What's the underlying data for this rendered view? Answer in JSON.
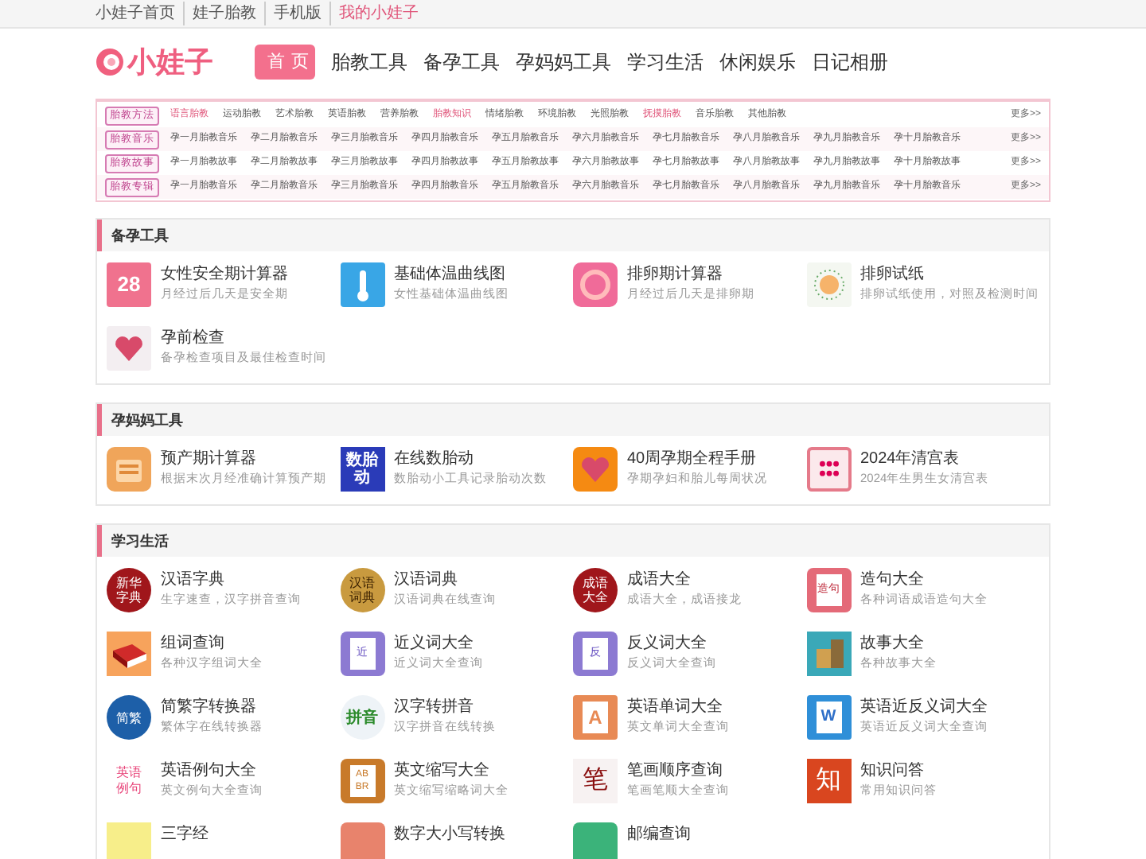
{
  "top_links": [
    "小娃子首页",
    "娃子胎教",
    "手机版",
    "我的小娃子"
  ],
  "logo": {
    "text": "小娃子"
  },
  "nav": [
    {
      "label": "首页",
      "selected": true
    },
    {
      "label": "胎教工具",
      "selected": false
    },
    {
      "label": "备孕工具",
      "selected": false
    },
    {
      "label": "孕妈妈工具",
      "selected": false
    },
    {
      "label": "学习生活",
      "selected": false
    },
    {
      "label": "休闲娱乐",
      "selected": false
    },
    {
      "label": "日记相册",
      "selected": false
    }
  ],
  "category_rows": [
    {
      "tag": "胎教方法",
      "more": "更多>>",
      "items": [
        {
          "label": "语言胎教",
          "highlighted": true
        },
        {
          "label": "运动胎教",
          "highlighted": false
        },
        {
          "label": "艺术胎教",
          "highlighted": false
        },
        {
          "label": "英语胎教",
          "highlighted": false
        },
        {
          "label": "营养胎教",
          "highlighted": false
        },
        {
          "label": "胎教知识",
          "highlighted": true
        },
        {
          "label": "情绪胎教",
          "highlighted": false
        },
        {
          "label": "环境胎教",
          "highlighted": false
        },
        {
          "label": "光照胎教",
          "highlighted": false
        },
        {
          "label": "抚摸胎教",
          "highlighted": true
        },
        {
          "label": "音乐胎教",
          "highlighted": false
        },
        {
          "label": "其他胎教",
          "highlighted": false
        }
      ]
    },
    {
      "tag": "胎教音乐",
      "more": "更多>>",
      "items": [
        {
          "label": "孕一月胎教音乐",
          "highlighted": false
        },
        {
          "label": "孕二月胎教音乐",
          "highlighted": false
        },
        {
          "label": "孕三月胎教音乐",
          "highlighted": false
        },
        {
          "label": "孕四月胎教音乐",
          "highlighted": false
        },
        {
          "label": "孕五月胎教音乐",
          "highlighted": false
        },
        {
          "label": "孕六月胎教音乐",
          "highlighted": false
        },
        {
          "label": "孕七月胎教音乐",
          "highlighted": false
        },
        {
          "label": "孕八月胎教音乐",
          "highlighted": false
        },
        {
          "label": "孕九月胎教音乐",
          "highlighted": false
        },
        {
          "label": "孕十月胎教音乐",
          "highlighted": false
        }
      ]
    },
    {
      "tag": "胎教故事",
      "more": "更多>>",
      "items": [
        {
          "label": "孕一月胎教故事",
          "highlighted": false
        },
        {
          "label": "孕二月胎教故事",
          "highlighted": false
        },
        {
          "label": "孕三月胎教故事",
          "highlighted": false
        },
        {
          "label": "孕四月胎教故事",
          "highlighted": false
        },
        {
          "label": "孕五月胎教故事",
          "highlighted": false
        },
        {
          "label": "孕六月胎教故事",
          "highlighted": false
        },
        {
          "label": "孕七月胎教故事",
          "highlighted": false
        },
        {
          "label": "孕八月胎教故事",
          "highlighted": false
        },
        {
          "label": "孕九月胎教故事",
          "highlighted": false
        },
        {
          "label": "孕十月胎教故事",
          "highlighted": false
        }
      ]
    },
    {
      "tag": "胎教专辑",
      "more": "更多>>",
      "items": [
        {
          "label": "孕一月胎教音乐",
          "highlighted": false
        },
        {
          "label": "孕二月胎教音乐",
          "highlighted": false
        },
        {
          "label": "孕三月胎教音乐",
          "highlighted": false
        },
        {
          "label": "孕四月胎教音乐",
          "highlighted": false
        },
        {
          "label": "孕五月胎教音乐",
          "highlighted": false
        },
        {
          "label": "孕六月胎教音乐",
          "highlighted": false
        },
        {
          "label": "孕七月胎教音乐",
          "highlighted": false
        },
        {
          "label": "孕八月胎教音乐",
          "highlighted": false
        },
        {
          "label": "孕九月胎教音乐",
          "highlighted": false
        },
        {
          "label": "孕十月胎教音乐",
          "highlighted": false
        }
      ]
    }
  ],
  "sections": [
    {
      "title": "备孕工具",
      "tools": [
        {
          "kind": "number",
          "icon_text": "28",
          "name": "女性安全期计算器",
          "desc": "月经过后几天是安全期"
        },
        {
          "kind": "thermometer",
          "name": "基础体温曲线图",
          "desc": "女性基础体温曲线图"
        },
        {
          "kind": "ring",
          "name": "排卵期计算器",
          "desc": "月经过后几天是排卵期"
        },
        {
          "kind": "sun",
          "name": "排卵试纸",
          "desc": "排卵试纸使用，对照及检测时间"
        },
        {
          "kind": "heart",
          "name": "孕前检查",
          "desc": "备孕检查项目及最佳检查时间"
        }
      ]
    },
    {
      "title": "孕妈妈工具",
      "tools": [
        {
          "kind": "calculator",
          "name": "预产期计算器",
          "desc": "根据末次月经准确计算预产期"
        },
        {
          "kind": "blue-text",
          "icon_text": "数胎动",
          "name": "在线数胎动",
          "desc": "数胎动小工具记录胎动次数"
        },
        {
          "kind": "card",
          "name": "40周孕期全程手册",
          "desc": "孕期孕妇和胎儿每周状况"
        },
        {
          "kind": "grid",
          "name": "2024年清宫表",
          "desc": "2024年生男生女清宫表"
        }
      ]
    },
    {
      "title": "学习生活",
      "tools": [
        {
          "kind": "red-circle",
          "icon_text": "新华字典",
          "name": "汉语字典",
          "desc": "生字速查，汉字拼音查询"
        },
        {
          "kind": "gold-circle",
          "icon_text": "汉语词典",
          "name": "汉语词典",
          "desc": "汉语词典在线查询"
        },
        {
          "kind": "red-circle",
          "icon_text": "成语大全",
          "name": "成语大全",
          "desc": "成语大全，成语接龙"
        },
        {
          "kind": "pink-book",
          "icon_text": "造句",
          "name": "造句大全",
          "desc": "各种词语成语造句大全"
        },
        {
          "kind": "red-book",
          "name": "组词查询",
          "desc": "各种汉字组词大全"
        },
        {
          "kind": "purple-doc",
          "icon_text": "近",
          "name": "近义词大全",
          "desc": "近义词大全查询"
        },
        {
          "kind": "purple-doc",
          "icon_text": "反",
          "name": "反义词大全",
          "desc": "反义词大全查询"
        },
        {
          "kind": "teal-books",
          "name": "故事大全",
          "desc": "各种故事大全"
        },
        {
          "kind": "blue-circle",
          "icon_text": "简繁",
          "name": "简繁字转换器",
          "desc": "繁体字在线转换器"
        },
        {
          "kind": "pinyin",
          "icon_text": "拼音",
          "name": "汉字转拼音",
          "desc": "汉字拼音在线转换"
        },
        {
          "kind": "letter",
          "icon_text": "A",
          "name": "英语单词大全",
          "desc": "英文单词大全查询"
        },
        {
          "kind": "letter-blue",
          "icon_text": "W",
          "name": "英语近反义词大全",
          "desc": "英语近反义词大全查询"
        },
        {
          "kind": "tiles",
          "icon_text": "英语例句",
          "name": "英语例句大全",
          "desc": "英文例句大全查询"
        },
        {
          "kind": "open-book",
          "icon_text": "AB BR",
          "name": "英文缩写大全",
          "desc": "英文缩写缩略词大全"
        },
        {
          "kind": "brush",
          "icon_text": "笔",
          "name": "笔画顺序查询",
          "desc": "笔画笔顺大全查询"
        },
        {
          "kind": "orange-red",
          "icon_text": "知",
          "name": "知识问答",
          "desc": "常用知识问答"
        },
        {
          "kind": "yellow",
          "name": "三字经"
        },
        {
          "kind": "salmon",
          "name": "数字大小写转换"
        },
        {
          "kind": "green",
          "name": "邮编查询"
        }
      ]
    }
  ]
}
